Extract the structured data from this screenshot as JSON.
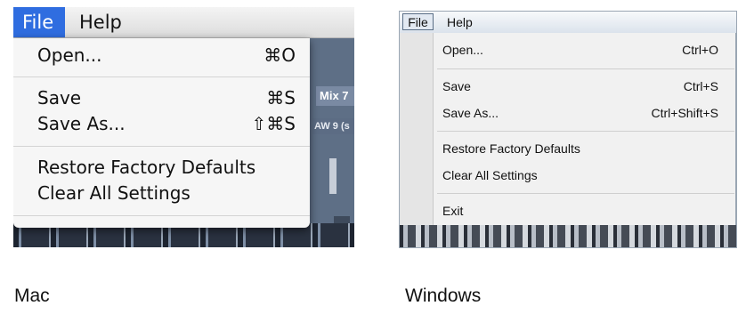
{
  "mac": {
    "menubar": {
      "file": "File",
      "help": "Help"
    },
    "background": {
      "mix_label": "Mix 7",
      "rw_label": "AW 9 (s"
    },
    "menu": {
      "open": {
        "label": "Open...",
        "shortcut": "⌘O"
      },
      "save": {
        "label": "Save",
        "shortcut": "⌘S"
      },
      "save_as": {
        "label": "Save As...",
        "shortcut": "⇧⌘S"
      },
      "restore": {
        "label": "Restore Factory Defaults"
      },
      "clear": {
        "label": "Clear All Settings"
      }
    },
    "caption": "Mac",
    "colors": {
      "highlight": "#2f6de0",
      "menu_bg": "#f6f6f6"
    }
  },
  "windows": {
    "menubar": {
      "file": "File",
      "help": "Help"
    },
    "menu": {
      "open": {
        "label": "Open...",
        "shortcut": "Ctrl+O"
      },
      "save": {
        "label": "Save",
        "shortcut": "Ctrl+S"
      },
      "save_as": {
        "label": "Save As...",
        "shortcut": "Ctrl+Shift+S"
      },
      "restore": {
        "label": "Restore Factory Defaults"
      },
      "clear": {
        "label": "Clear All Settings"
      },
      "exit": {
        "label": "Exit"
      }
    },
    "caption": "Windows",
    "colors": {
      "menu_bg": "#f1f1f1",
      "gutter": "#e5e5e5"
    }
  }
}
